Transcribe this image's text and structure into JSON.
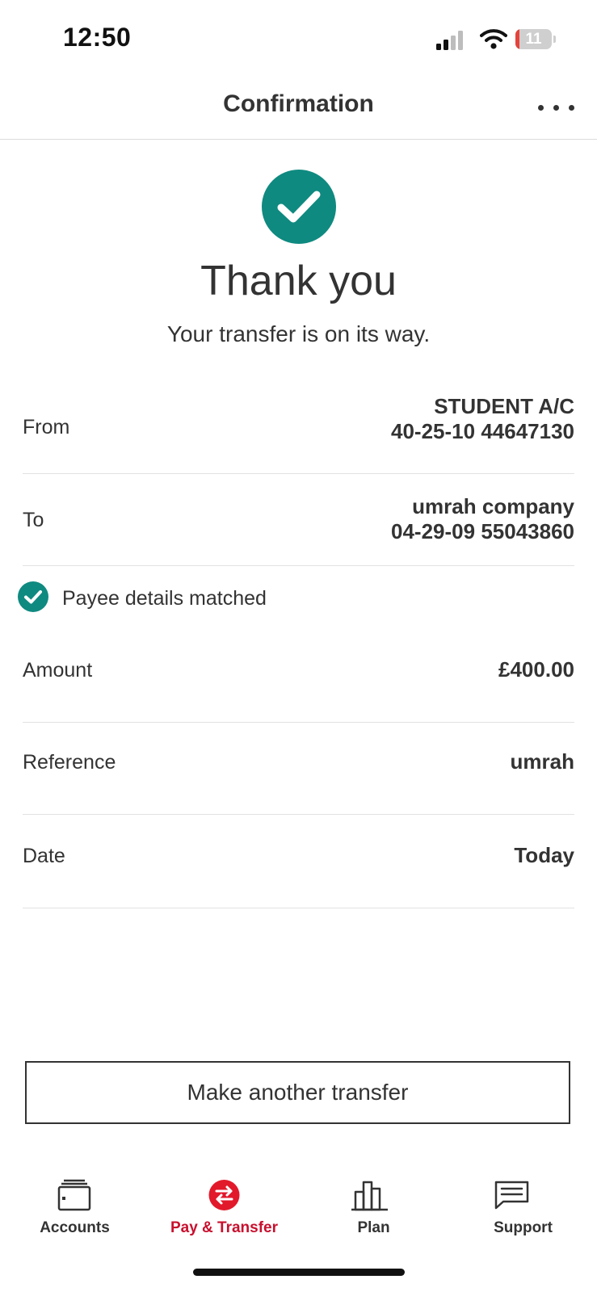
{
  "status_bar": {
    "time": "12:50",
    "battery": "11",
    "battery_level_percent": 11
  },
  "header": {
    "title": "Confirmation"
  },
  "confirmation": {
    "title": "Thank you",
    "subtitle": "Your transfer is on its way."
  },
  "details": {
    "from": {
      "label": "From",
      "account_name": "STUDENT A/C",
      "account_number": "40-25-10 44647130"
    },
    "to": {
      "label": "To",
      "payee_name": "umrah company",
      "account_number": "04-29-09 55043860"
    },
    "payee_match": "Payee details matched",
    "amount": {
      "label": "Amount",
      "value": "£400.00"
    },
    "reference": {
      "label": "Reference",
      "value": "umrah"
    },
    "date": {
      "label": "Date",
      "value": "Today"
    }
  },
  "actions": {
    "make_another": "Make another transfer"
  },
  "tabs": [
    {
      "label": "Accounts",
      "icon": "wallet-icon",
      "active": false
    },
    {
      "label": "Pay & Transfer",
      "icon": "transfer-icon",
      "active": true
    },
    {
      "label": "Plan",
      "icon": "bar-chart-icon",
      "active": false
    },
    {
      "label": "Support",
      "icon": "chat-icon",
      "active": false
    }
  ],
  "colors": {
    "accent": "#0f8a80",
    "brand_red": "#c8102e",
    "text": "#333333",
    "battery_low": "#e5433b"
  }
}
